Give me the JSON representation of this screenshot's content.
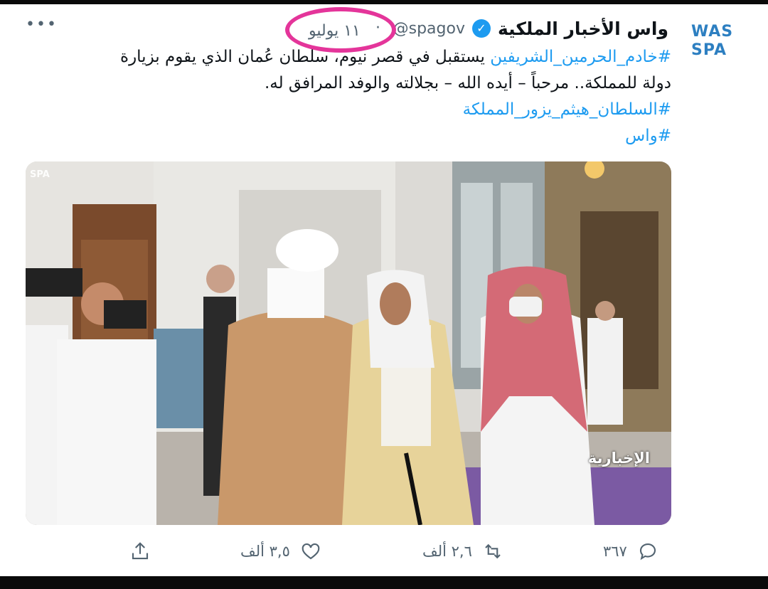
{
  "tweet": {
    "display_name": "واس الأخبار الملكية",
    "handle": "@spagov",
    "date": "١١ يوليو",
    "separator": "·",
    "more_label": "•••",
    "lines": [
      {
        "hashtag": "#خادم_الحرمين_الشريفين",
        "text": " يستقبل في قصر نيوم، سلطان عُمان الذي يقوم بزيارة"
      },
      {
        "text": "دولة للمملكة.. مرحباً – أيده الله – بجلالته والوفد المرافق له."
      },
      {
        "hashtag": "#السلطان_هيثم_يزور_المملكة"
      },
      {
        "hashtag": "#واس"
      }
    ],
    "avatar_logo": {
      "top": "WAS",
      "bottom": "SPA"
    },
    "media": {
      "watermark_agency": "SPA",
      "watermark_channel": "الإخبارية"
    }
  },
  "actions": {
    "reply_count": "٣٦٧",
    "retweet_count": "٢,٦ ألف",
    "like_count": "٣,٥ ألف"
  },
  "colors": {
    "accent": "#1d9bf0",
    "muted": "#536471",
    "highlight_ring": "#e4359a",
    "logo": "#2d7fc1"
  },
  "icons": [
    "verified-badge-icon",
    "more-icon",
    "reply-icon",
    "retweet-icon",
    "like-icon",
    "share-icon"
  ]
}
